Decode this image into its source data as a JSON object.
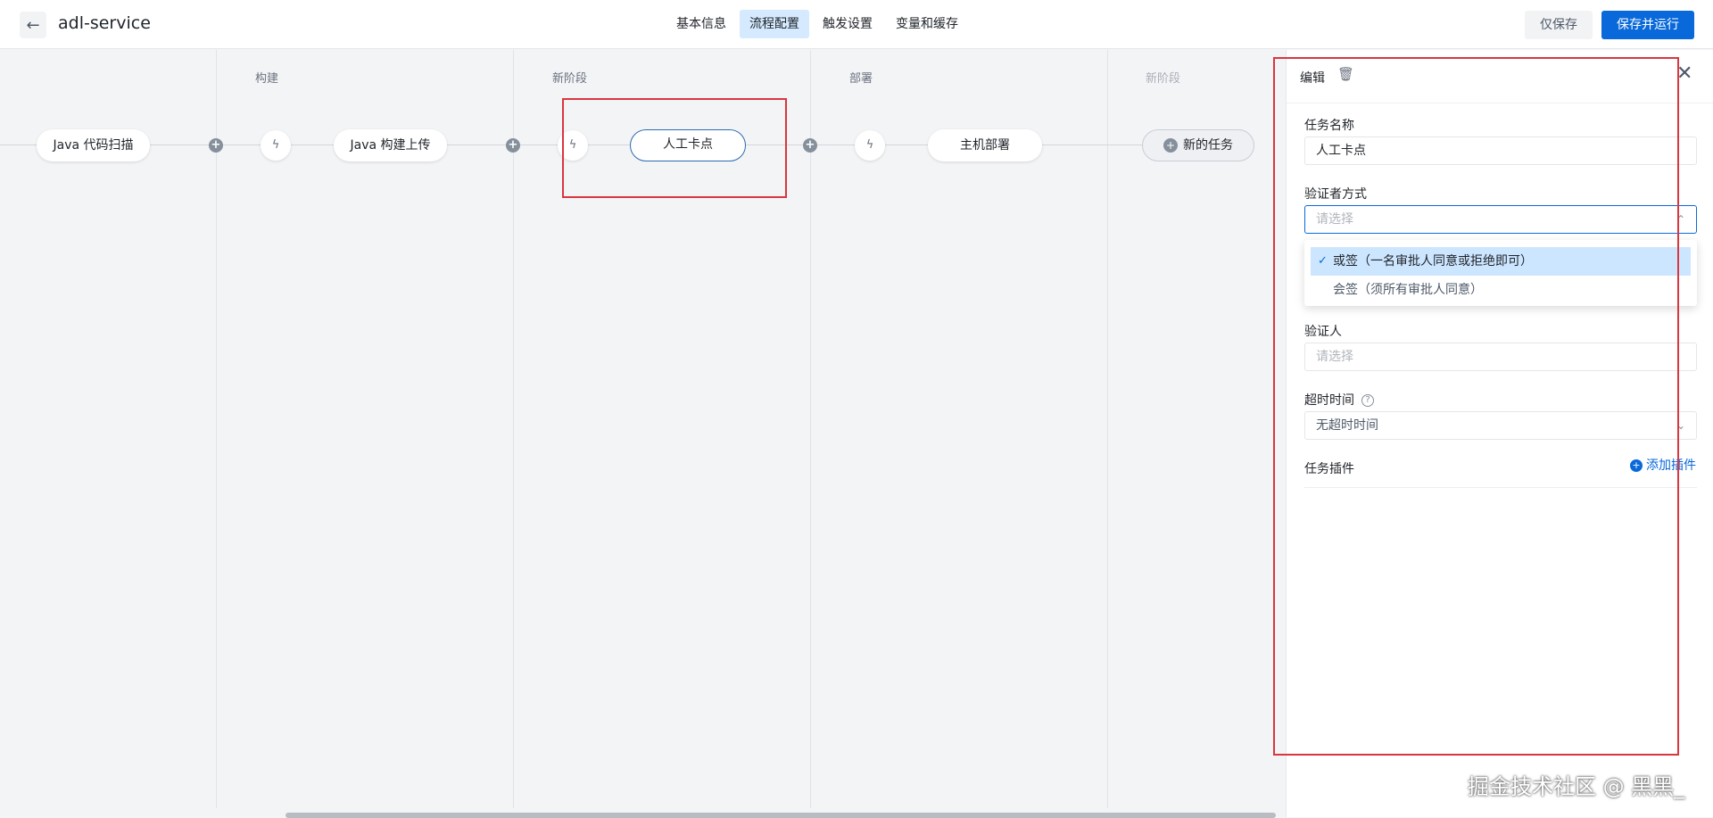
{
  "header": {
    "back_icon": "arrow-left-icon",
    "title": "adl-service",
    "tabs": [
      {
        "label": "基本信息",
        "active": false
      },
      {
        "label": "流程配置",
        "active": true
      },
      {
        "label": "触发设置",
        "active": false
      },
      {
        "label": "变量和缓存",
        "active": false
      }
    ],
    "save_only_label": "仅保存",
    "save_run_label": "保存并运行"
  },
  "pipeline": {
    "stages": [
      {
        "title": "构建",
        "muted": false
      },
      {
        "title": "新阶段",
        "muted": false
      },
      {
        "title": "部署",
        "muted": false
      },
      {
        "title": "新阶段",
        "muted": true
      }
    ],
    "tasks": [
      {
        "label": "Java 代码扫描"
      },
      {
        "label": "Java 构建上传"
      },
      {
        "label": "人工卡点",
        "selected": true
      },
      {
        "label": "主机部署"
      }
    ],
    "new_task_label": "新的任务",
    "trigger_icon": "lightning-icon",
    "add_icon": "plus-circle-icon"
  },
  "panel": {
    "edit_label": "编辑",
    "trash_icon": "trash-icon",
    "close_icon": "close-icon",
    "task_name": {
      "label": "任务名称",
      "value": "人工卡点"
    },
    "verifier_mode": {
      "label": "验证者方式",
      "placeholder": "请选择",
      "options": [
        {
          "label": "或签（一名审批人同意或拒绝即可）",
          "selected": true
        },
        {
          "label": "会签（须所有审批人同意）",
          "selected": false
        }
      ]
    },
    "verifier": {
      "label": "验证人",
      "placeholder": "请选择"
    },
    "timeout": {
      "label": "超时时间",
      "value": "无超时时间",
      "help_icon": "question-circle-icon"
    },
    "plugins": {
      "label": "任务插件",
      "add_label": "添加插件"
    }
  },
  "watermark": "掘金技术社区 @ 黑黑_",
  "colors": {
    "primary": "#0969da",
    "highlight": "#d9363e",
    "tab_active": "#d5eaff"
  }
}
